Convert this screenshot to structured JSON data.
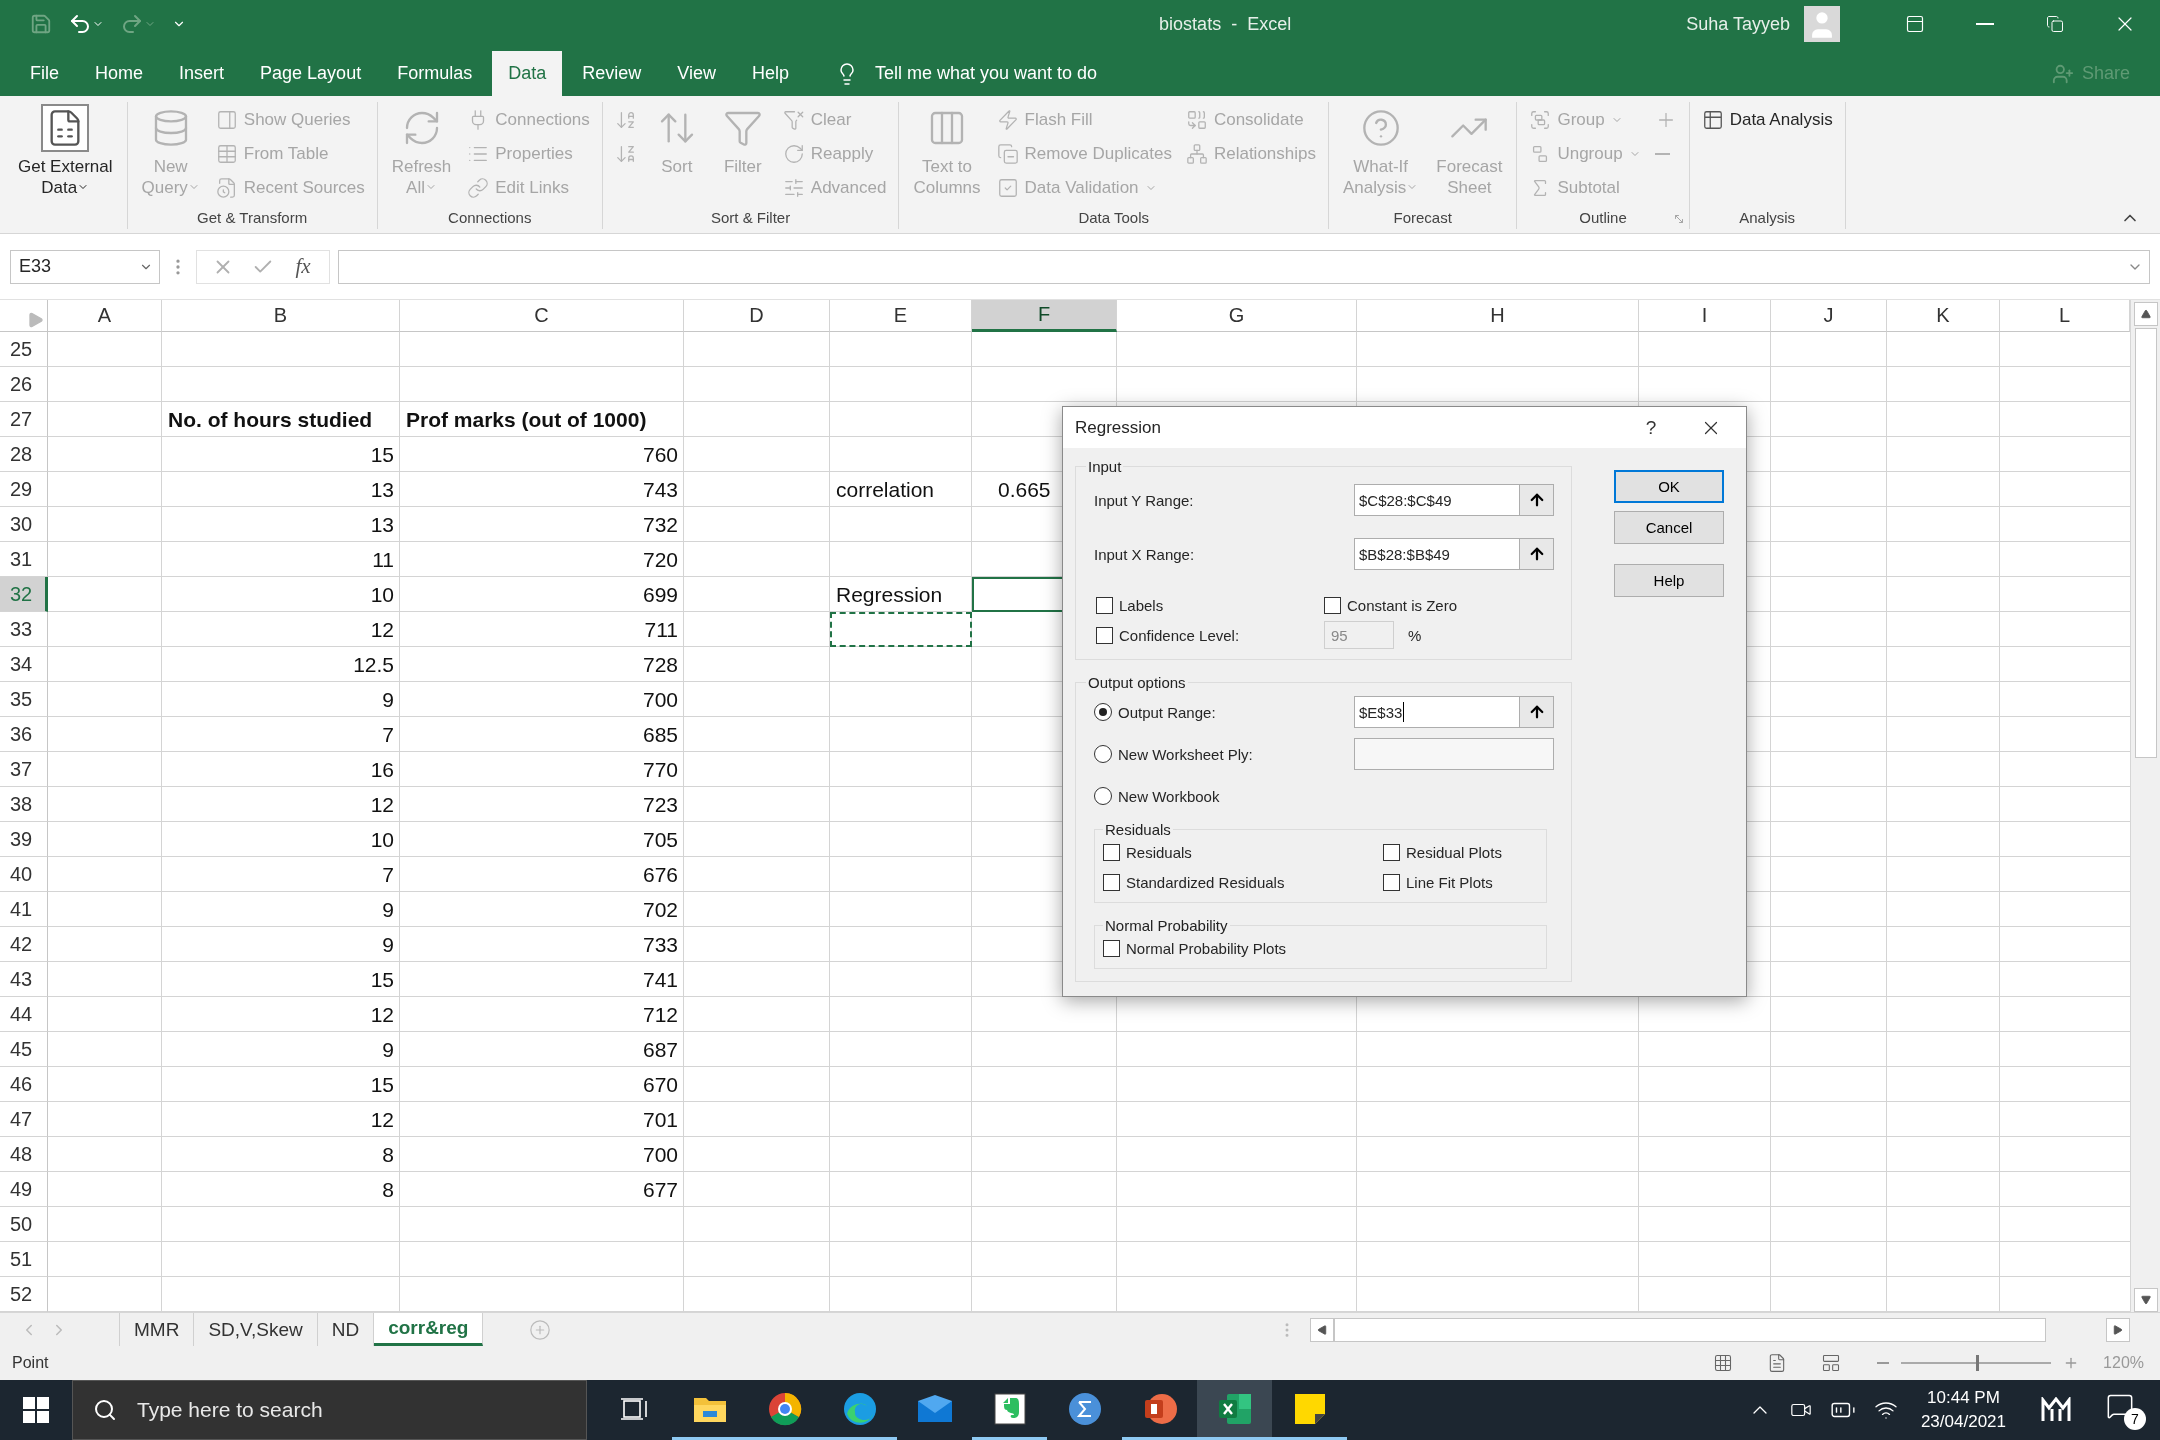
{
  "title_bar": {
    "title": "biostats  -  Excel",
    "user": "Suha Tayyeb"
  },
  "ribbon_tabs": [
    {
      "label": "File",
      "selected": false
    },
    {
      "label": "Home",
      "selected": false
    },
    {
      "label": "Insert",
      "selected": false
    },
    {
      "label": "Page Layout",
      "selected": false
    },
    {
      "label": "Formulas",
      "selected": false
    },
    {
      "label": "Data",
      "selected": true
    },
    {
      "label": "Review",
      "selected": false
    },
    {
      "label": "View",
      "selected": false
    },
    {
      "label": "Help",
      "selected": false
    }
  ],
  "tell_me": "Tell me what you want to do",
  "share": "Share",
  "ribbon_groups": [
    {
      "items": [
        {
          "label": "Get External\nData",
          "kind": "large",
          "disabled": false,
          "dropdown": true
        }
      ]
    },
    {
      "label": "Get & Transform",
      "items": [
        {
          "label": "New\nQuery",
          "kind": "large",
          "disabled": true,
          "dropdown": true
        },
        {
          "label": "Show Queries",
          "kind": "small",
          "disabled": true,
          "dropdown": false
        },
        {
          "label": "From Table",
          "kind": "small",
          "disabled": true,
          "dropdown": false
        },
        {
          "label": "Recent Sources",
          "kind": "small",
          "disabled": true,
          "dropdown": false
        }
      ]
    },
    {
      "label": "Connections",
      "items": [
        {
          "label": "Refresh\nAll",
          "kind": "large",
          "disabled": true,
          "dropdown": true
        },
        {
          "label": "Connections",
          "kind": "small",
          "disabled": true,
          "dropdown": false
        },
        {
          "label": "Properties",
          "kind": "small",
          "disabled": true,
          "dropdown": false
        },
        {
          "label": "Edit Links",
          "kind": "small",
          "disabled": true,
          "dropdown": false
        }
      ]
    },
    {
      "label": "Sort & Filter",
      "items": [
        {
          "kind": "icon",
          "disabled": true,
          "dropdown": false
        },
        {
          "kind": "icon",
          "disabled": true,
          "dropdown": false
        },
        {
          "label": "Sort",
          "kind": "large",
          "disabled": true,
          "dropdown": false
        },
        {
          "label": "Filter",
          "kind": "large",
          "disabled": true,
          "dropdown": false
        },
        {
          "label": "Clear",
          "kind": "small",
          "disabled": true,
          "dropdown": false
        },
        {
          "label": "Reapply",
          "kind": "small",
          "disabled": true,
          "dropdown": false
        },
        {
          "label": "Advanced",
          "kind": "small",
          "disabled": true,
          "dropdown": false
        }
      ]
    },
    {
      "label": "Data Tools",
      "items": [
        {
          "label": "Text to\nColumns",
          "kind": "large",
          "disabled": true,
          "dropdown": false
        },
        {
          "label": "Flash Fill",
          "kind": "small",
          "disabled": true,
          "dropdown": false
        },
        {
          "label": "Remove Duplicates",
          "kind": "small",
          "disabled": true,
          "dropdown": false
        },
        {
          "label": "Data Validation",
          "kind": "small",
          "disabled": true,
          "dropdown": true
        },
        {
          "label": "Consolidate",
          "kind": "small",
          "disabled": true,
          "dropdown": false
        },
        {
          "label": "Relationships",
          "kind": "small",
          "disabled": true,
          "dropdown": false
        }
      ]
    },
    {
      "label": "Forecast",
      "items": [
        {
          "label": "What-If\nAnalysis",
          "kind": "large",
          "disabled": true,
          "dropdown": true
        },
        {
          "label": "Forecast\nSheet",
          "kind": "large",
          "disabled": true,
          "dropdown": false
        }
      ]
    },
    {
      "label": "Outline",
      "items": [
        {
          "label": "Group",
          "kind": "small",
          "disabled": true,
          "dropdown": true
        },
        {
          "label": "Ungroup",
          "kind": "small",
          "disabled": true,
          "dropdown": true
        },
        {
          "label": "Subtotal",
          "kind": "small",
          "disabled": true,
          "dropdown": false
        },
        {
          "kind": "icon",
          "disabled": true,
          "dropdown": false
        },
        {
          "kind": "icon",
          "disabled": true,
          "dropdown": false
        }
      ]
    },
    {
      "label": "Analysis",
      "items": [
        {
          "label": "Data Analysis",
          "kind": "small",
          "disabled": false,
          "dropdown": false
        }
      ]
    }
  ],
  "formula_bar": {
    "name_box": "E33",
    "function_label": "fx"
  },
  "sheet": {
    "columns": [
      {
        "label": "A",
        "selected": false,
        "marquee": false
      },
      {
        "label": "B",
        "selected": false,
        "marquee": false
      },
      {
        "label": "C",
        "selected": false,
        "marquee": false
      },
      {
        "label": "D",
        "selected": false,
        "marquee": false
      },
      {
        "label": "E",
        "selected": false,
        "marquee": true
      },
      {
        "label": "F",
        "selected": true,
        "marquee": false
      },
      {
        "label": "G",
        "selected": false,
        "marquee": false
      },
      {
        "label": "H",
        "selected": false,
        "marquee": false
      },
      {
        "label": "I",
        "selected": false,
        "marquee": false
      },
      {
        "label": "J",
        "selected": false,
        "marquee": false
      },
      {
        "label": "K",
        "selected": false,
        "marquee": false
      },
      {
        "label": "L",
        "selected": false,
        "marquee": false
      }
    ],
    "rows": [
      {
        "number": "25",
        "kind": "data",
        "selected": false,
        "marquee": false
      },
      {
        "number": "26",
        "kind": "data",
        "selected": false,
        "marquee": false
      },
      {
        "number": "27",
        "kind": "heading",
        "selected": false,
        "marquee": false,
        "column_b": "No. of hours studied",
        "column_c": "Prof marks (out of 1000)"
      },
      {
        "number": "28",
        "kind": "data",
        "selected": false,
        "marquee": false,
        "column_b": "15",
        "column_c": "760"
      },
      {
        "number": "29",
        "kind": "data",
        "selected": false,
        "marquee": false,
        "column_b": "13",
        "column_c": "743",
        "column_e": "correlation",
        "column_f": "0.665"
      },
      {
        "number": "30",
        "kind": "data",
        "selected": false,
        "marquee": false,
        "column_b": "13",
        "column_c": "732"
      },
      {
        "number": "31",
        "kind": "data",
        "selected": false,
        "marquee": false,
        "column_b": "11",
        "column_c": "720"
      },
      {
        "number": "32",
        "kind": "data",
        "selected": true,
        "marquee": false,
        "column_b": "10",
        "column_c": "699",
        "column_e": "Regression"
      },
      {
        "number": "33",
        "kind": "data",
        "selected": false,
        "marquee": true,
        "column_b": "12",
        "column_c": "711"
      },
      {
        "number": "34",
        "kind": "data",
        "selected": false,
        "marquee": false,
        "column_b": "12.5",
        "column_c": "728"
      },
      {
        "number": "35",
        "kind": "data",
        "selected": false,
        "marquee": false,
        "column_b": "9",
        "column_c": "700"
      },
      {
        "number": "36",
        "kind": "data",
        "selected": false,
        "marquee": false,
        "column_b": "7",
        "column_c": "685"
      },
      {
        "number": "37",
        "kind": "data",
        "selected": false,
        "marquee": false,
        "column_b": "16",
        "column_c": "770"
      },
      {
        "number": "38",
        "kind": "data",
        "selected": false,
        "marquee": false,
        "column_b": "12",
        "column_c": "723"
      },
      {
        "number": "39",
        "kind": "data",
        "selected": false,
        "marquee": false,
        "column_b": "10",
        "column_c": "705"
      },
      {
        "number": "40",
        "kind": "data",
        "selected": false,
        "marquee": false,
        "column_b": "7",
        "column_c": "676"
      },
      {
        "number": "41",
        "kind": "data",
        "selected": false,
        "marquee": false,
        "column_b": "9",
        "column_c": "702"
      },
      {
        "number": "42",
        "kind": "data",
        "selected": false,
        "marquee": false,
        "column_b": "9",
        "column_c": "733"
      },
      {
        "number": "43",
        "kind": "data",
        "selected": false,
        "marquee": false,
        "column_b": "15",
        "column_c": "741"
      },
      {
        "number": "44",
        "kind": "data",
        "selected": false,
        "marquee": false,
        "column_b": "12",
        "column_c": "712"
      },
      {
        "number": "45",
        "kind": "data",
        "selected": false,
        "marquee": false,
        "column_b": "9",
        "column_c": "687"
      },
      {
        "number": "46",
        "kind": "data",
        "selected": false,
        "marquee": false,
        "column_b": "15",
        "column_c": "670"
      },
      {
        "number": "47",
        "kind": "data",
        "selected": false,
        "marquee": false,
        "column_b": "12",
        "column_c": "701"
      },
      {
        "number": "48",
        "kind": "data",
        "selected": false,
        "marquee": false,
        "column_b": "8",
        "column_c": "700"
      },
      {
        "number": "49",
        "kind": "data",
        "selected": false,
        "marquee": false,
        "column_b": "8",
        "column_c": "677"
      },
      {
        "number": "50",
        "kind": "data",
        "selected": false,
        "marquee": false
      },
      {
        "number": "51",
        "kind": "data",
        "selected": false,
        "marquee": false
      },
      {
        "number": "52",
        "kind": "data",
        "selected": false,
        "marquee": false
      }
    ]
  },
  "dialog": {
    "title": "Regression",
    "help": "?",
    "input": {
      "legend": "Input",
      "ranges": [
        {
          "label": "Input Y Range:",
          "value": "$C$28:$C$49"
        },
        {
          "label": "Input X Range:",
          "value": "$B$28:$B$49"
        }
      ],
      "options": [
        {
          "label": "Labels",
          "checked": false
        },
        {
          "label": "Constant is Zero",
          "checked": false
        },
        {
          "label": "Confidence Level:",
          "checked": false
        }
      ],
      "confidence": {
        "value": "95",
        "disabled": true,
        "unit": "%"
      }
    },
    "output": {
      "legend": "Output options",
      "choices": [
        {
          "label": "Output Range:",
          "selected": true,
          "kind": "range",
          "value": "$E$33"
        },
        {
          "label": "New Worksheet Ply:",
          "selected": false,
          "kind": "name"
        },
        {
          "label": "New Workbook",
          "selected": false,
          "kind": "plain"
        }
      ],
      "residuals": {
        "legend": "Residuals",
        "options": [
          {
            "label": "Residuals",
            "checked": false
          },
          {
            "label": "Residual Plots",
            "checked": false
          },
          {
            "label": "Standardized Residuals",
            "checked": false
          },
          {
            "label": "Line Fit Plots",
            "checked": false
          }
        ]
      },
      "normal": {
        "legend": "Normal Probability",
        "options": [
          {
            "label": "Normal Probability Plots",
            "checked": false
          }
        ]
      }
    },
    "buttons": [
      {
        "label": "OK",
        "default": true
      },
      {
        "label": "Cancel",
        "default": false
      },
      {
        "label": "Help",
        "default": false
      }
    ]
  },
  "sheet_tabs": [
    {
      "label": "MMR",
      "selected": false
    },
    {
      "label": "SD,V,Skew",
      "selected": false
    },
    {
      "label": "ND",
      "selected": false
    },
    {
      "label": "corr&reg",
      "selected": true
    }
  ],
  "status_bar": {
    "mode": "Point",
    "zoom": "120%",
    "zoom_slider": {
      "level": 0.5
    }
  },
  "taskbar": {
    "search_placeholder": "Type here to search",
    "time": "10:44 PM",
    "date": "23/04/2021",
    "notifications": "7"
  }
}
